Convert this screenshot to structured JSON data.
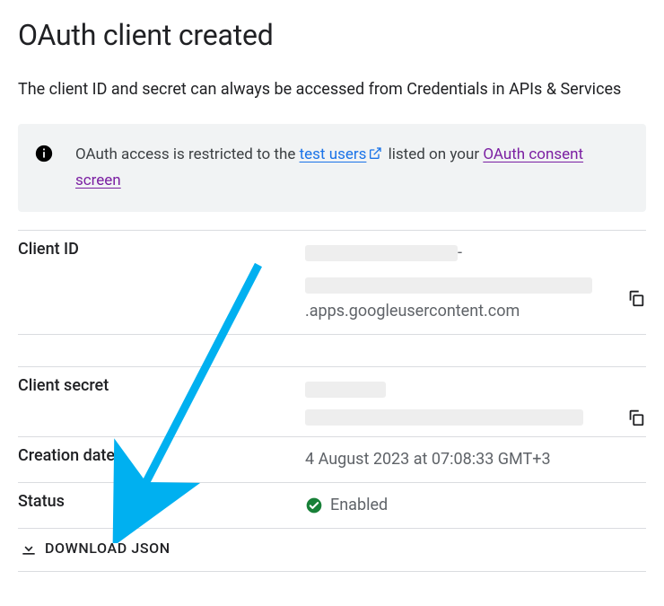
{
  "title": "OAuth client created",
  "subtitle": "The client ID and secret can always be accessed from Credentials in APIs & Services",
  "notice": {
    "prefix": "OAuth access is restricted to the ",
    "link1_text": "test users",
    "middle": " listed on your ",
    "link2_text": "OAuth consent screen"
  },
  "fields": {
    "client_id_label": "Client ID",
    "client_id_suffix1": "-",
    "client_id_suffix2": ".apps.googleusercontent.com",
    "client_secret_label": "Client secret",
    "creation_date_label": "Creation date",
    "creation_date_value": "4 August 2023 at 07:08:33 GMT+3",
    "status_label": "Status",
    "status_value": "Enabled"
  },
  "download_button": "DOWNLOAD JSON"
}
